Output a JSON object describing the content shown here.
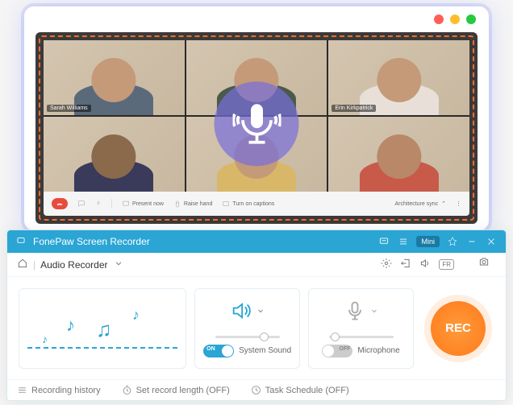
{
  "video_call": {
    "participants": [
      {
        "name": "Sarah Williams"
      },
      {
        "name": ""
      },
      {
        "name": "Erin Kirkpatrick"
      },
      {
        "name": ""
      },
      {
        "name": ""
      },
      {
        "name": ""
      }
    ],
    "toolbar": {
      "present": "Present now",
      "raise": "Raise hand",
      "captions": "Turn on captions",
      "arch": "Architecture sync"
    }
  },
  "recorder": {
    "title": "FonePaw Screen Recorder",
    "mini_label": "Mini",
    "mode": "Audio Recorder",
    "fr_badge": "FR",
    "system_sound": {
      "label": "System Sound",
      "state": "ON",
      "on": true
    },
    "microphone": {
      "label": "Microphone",
      "state": "OFF",
      "on": false
    },
    "rec": "REC",
    "footer": {
      "history": "Recording history",
      "length": "Set record length (OFF)",
      "schedule": "Task Schedule (OFF)"
    }
  }
}
